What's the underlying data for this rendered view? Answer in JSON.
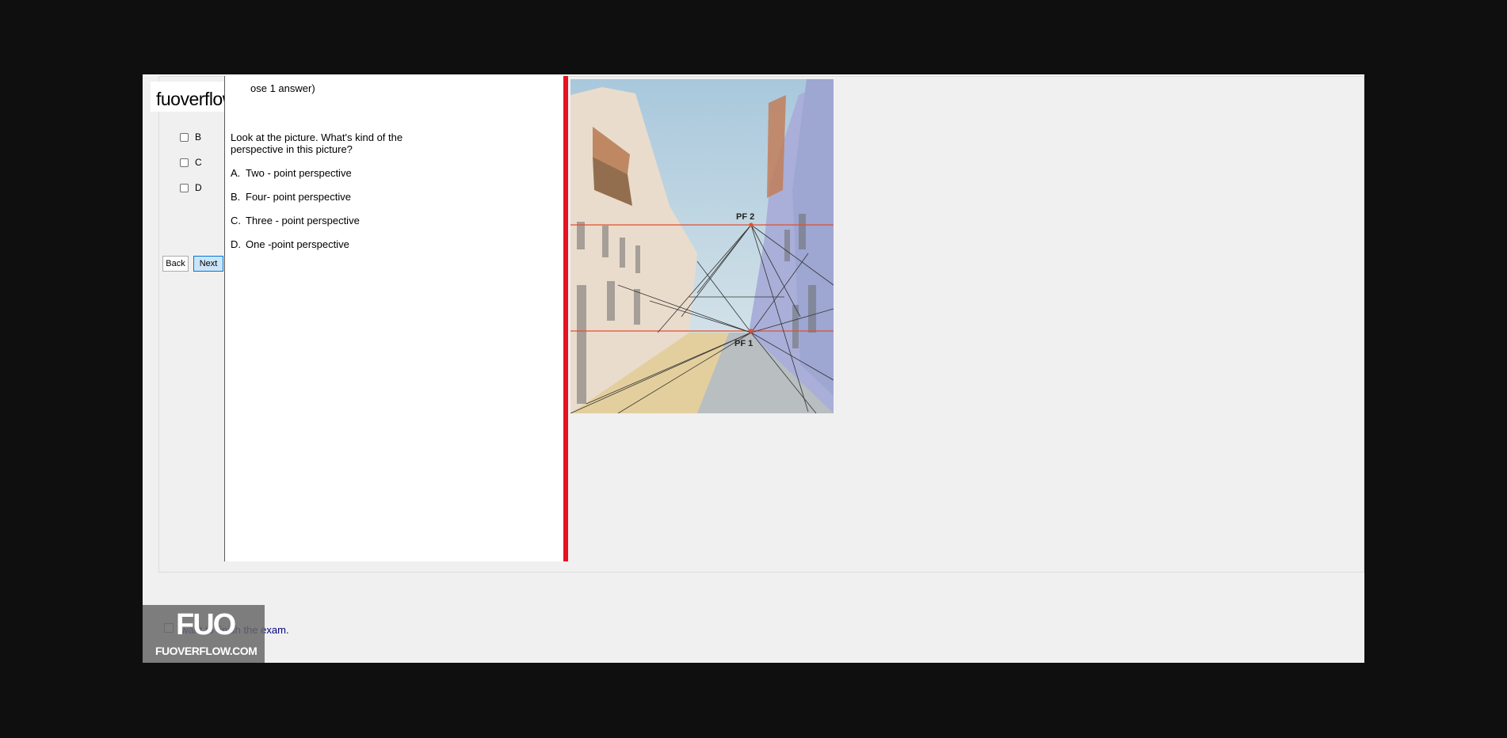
{
  "brand": {
    "logo_text": "fuoverflow"
  },
  "question": {
    "header": "ose 1 answer)",
    "text": "Look at the picture. What's kind of the perspective in this picture?",
    "options": [
      {
        "key": "A.",
        "text": "Two - point perspective"
      },
      {
        "key": "B.",
        "text": "Four- point perspective"
      },
      {
        "key": "C.",
        "text": "Three - point perspective"
      },
      {
        "key": "D.",
        "text": "One -point perspective"
      }
    ]
  },
  "answer_choices": [
    {
      "label": "B"
    },
    {
      "label": "C"
    },
    {
      "label": "D"
    }
  ],
  "nav": {
    "back_label": "Back",
    "next_label": "Next"
  },
  "picture": {
    "labels": {
      "pf2": "PF 2",
      "pf1": "PF 1"
    }
  },
  "footer": {
    "finish_text": "want to finish the exam."
  },
  "watermark": {
    "brand": "FUO",
    "site": "FUOVERFLOW.COM"
  },
  "colors": {
    "divider": "#e81123",
    "next_button": "#cce4f7",
    "footer_text": "#000080"
  }
}
